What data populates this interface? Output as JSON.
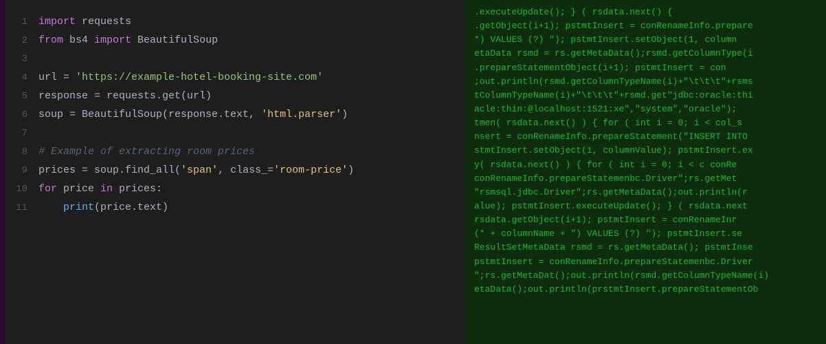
{
  "leftBar": {},
  "codePanel": {
    "lines": [
      {
        "num": "1",
        "tokens": [
          {
            "type": "kw-import",
            "text": "import"
          },
          {
            "type": "plain",
            "text": " requests"
          }
        ]
      },
      {
        "num": "2",
        "tokens": [
          {
            "type": "kw-from",
            "text": "from"
          },
          {
            "type": "plain",
            "text": " bs4 "
          },
          {
            "type": "kw-import",
            "text": "import"
          },
          {
            "type": "plain",
            "text": " BeautifulSoup"
          }
        ]
      },
      {
        "num": "3",
        "tokens": []
      },
      {
        "num": "4",
        "tokens": [
          {
            "type": "plain",
            "text": "url = "
          },
          {
            "type": "string-green",
            "text": "'https://example-hotel-booking-site.com'"
          }
        ]
      },
      {
        "num": "5",
        "tokens": [
          {
            "type": "plain",
            "text": "response = requests.get(url)"
          }
        ]
      },
      {
        "num": "6",
        "tokens": [
          {
            "type": "plain",
            "text": "soup = BeautifulSoup(response.text, "
          },
          {
            "type": "string-orange",
            "text": "'html.parser'"
          },
          {
            "type": "plain",
            "text": ")"
          }
        ]
      },
      {
        "num": "7",
        "tokens": []
      },
      {
        "num": "8",
        "tokens": [
          {
            "type": "comment",
            "text": "# Example of extracting room prices"
          }
        ]
      },
      {
        "num": "9",
        "tokens": [
          {
            "type": "plain",
            "text": "prices = soup.find_all("
          },
          {
            "type": "string-orange",
            "text": "'span'"
          },
          {
            "type": "plain",
            "text": ", class_="
          },
          {
            "type": "string-orange",
            "text": "'room-price'"
          },
          {
            "type": "plain",
            "text": ")"
          }
        ]
      },
      {
        "num": "10",
        "tokens": [
          {
            "type": "kw-for",
            "text": "for"
          },
          {
            "type": "plain",
            "text": " price "
          },
          {
            "type": "kw-in",
            "text": "in"
          },
          {
            "type": "plain",
            "text": " prices:"
          }
        ]
      },
      {
        "num": "11",
        "tokens": [
          {
            "type": "plain",
            "text": "    "
          },
          {
            "type": "kw-print",
            "text": "print"
          },
          {
            "type": "plain",
            "text": "(price.text)"
          }
        ]
      }
    ]
  },
  "bgPanel": {
    "code": ".executeUpdate(); } ( rsdata.next() {\n.getObject(i+1); pstmtInsert = conRenameInfo.prepare\n*) VALUES (?) \"); pstmtInsert.setObject(1, column\netaData rsmd = rs.getMetaData();rsmd.getColumnType(i\n.prepareStatementObject(i+1); pstmtInsert = con\n;out.println(rsmd.getColumnTypeName(i)+\"\\t\\t\\t\"+rsms\ntColumnTypeName(i)+\"\\t\\t\\t\"+rsmd.get\"jdbc:oracle:thi\nacle:thin:@localhost:1521:xe\",\"system\",\"oracle\");\ntmen( rsdata.next() ) { for ( int i = 0; i < col_s\nnsert = conRenameInfo.prepareStatement(\"INSERT INTO\nstmtInsert.setObject(1, columnValue); pstmtInsert.ex\ny( rsdata.next() ) { for ( int i = 0; i < c conRe\nconRenameInfo.prepareStatemenbc.Driver\";rs.getMet\n\"rsmsql.jdbc.Driver\";rs.getMetaData();out.println(r\nalue); pstmtInsert.executeUpdate(); } ( rsdata.next\nrsdata.getObject(i+1); pstmtInsert = conRenameInr\n(* + columnName + \") VALUES (?) \"); pstmtInsert.se\nResultSetMetaData rsmd = rs.getMetaData(); pstmtInse\npstmtInsert = conRenameInfo.prepareStatemenbc.Driver\n\";rs.getMetaDat();out.println(rsmd.getColumnTypeName(i)\netaData();out.println(prstmtInsert.prepareStatementOb"
  }
}
